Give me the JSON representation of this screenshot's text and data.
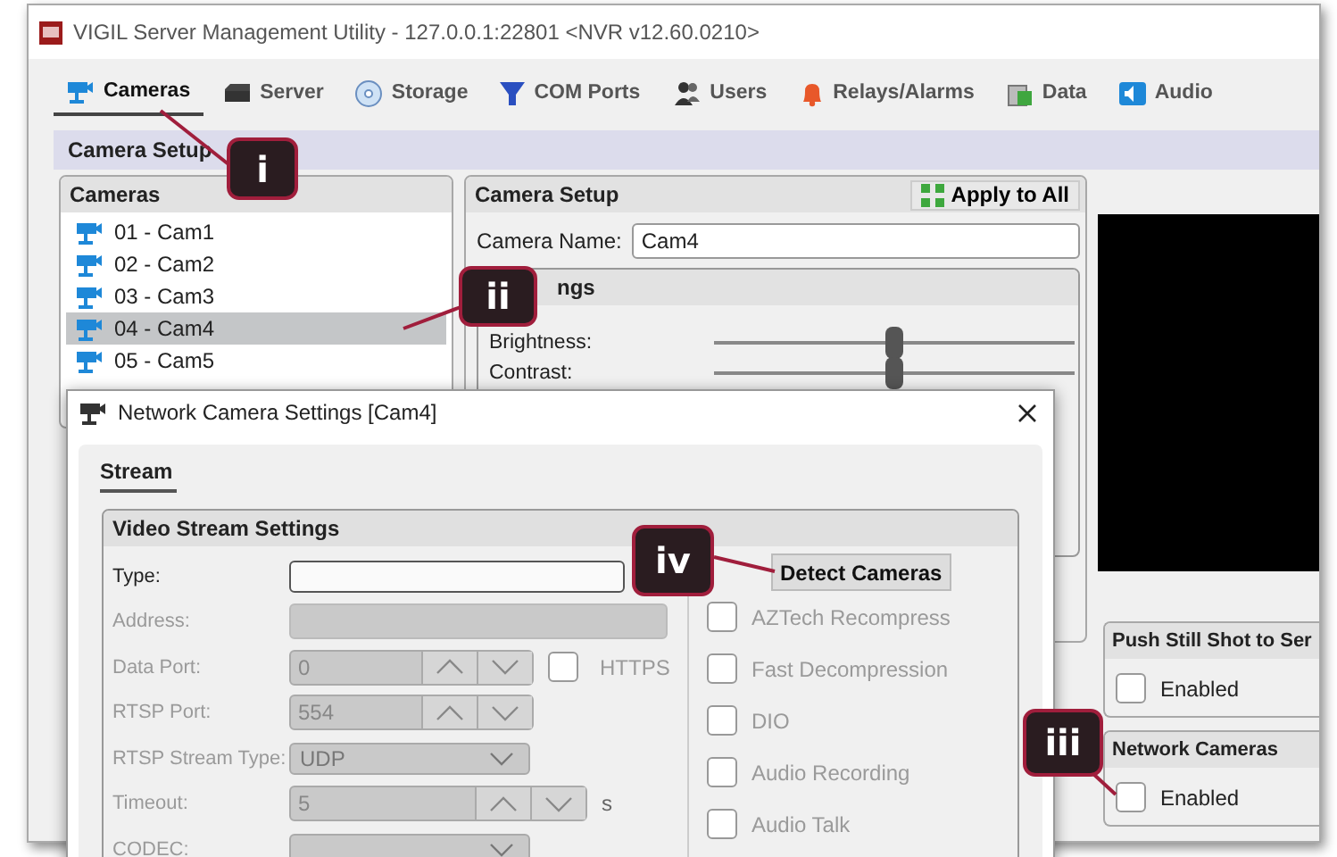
{
  "window": {
    "title": "VIGIL Server Management Utility - 127.0.0.1:22801 <NVR v12.60.0210>"
  },
  "tabs": [
    {
      "label": "Cameras",
      "selected": true
    },
    {
      "label": "Server",
      "selected": false
    },
    {
      "label": "Storage",
      "selected": false
    },
    {
      "label": "COM Ports",
      "selected": false
    },
    {
      "label": "Users",
      "selected": false
    },
    {
      "label": "Relays/Alarms",
      "selected": false
    },
    {
      "label": "Data",
      "selected": false
    },
    {
      "label": "Audio",
      "selected": false
    }
  ],
  "section_title": "Camera Setup",
  "cameras_panel": {
    "title": "Cameras",
    "items": [
      {
        "label": "01 - Cam1",
        "selected": false
      },
      {
        "label": "02 - Cam2",
        "selected": false
      },
      {
        "label": "03 - Cam3",
        "selected": false
      },
      {
        "label": "04 - Cam4",
        "selected": true
      },
      {
        "label": "05 - Cam5",
        "selected": false
      }
    ]
  },
  "camera_setup": {
    "title": "Camera Setup",
    "apply_button": "Apply to All",
    "name_label": "Camera Name:",
    "name_value": "Cam4",
    "settings": {
      "title": "ngs",
      "sliders": [
        {
          "label": "Brightness:",
          "level": 0.5
        },
        {
          "label": "Contrast:",
          "level": 0.5
        }
      ]
    }
  },
  "side_panels": [
    {
      "title": "Push Still Shot to Ser",
      "checkbox": {
        "label": "Enabled",
        "checked": false
      }
    },
    {
      "title": "Network Cameras",
      "checkbox": {
        "label": "Enabled",
        "checked": false
      }
    }
  ],
  "dialog": {
    "title": "Network Camera Settings [Cam4]",
    "tabs": [
      {
        "label": "Stream",
        "selected": true
      }
    ],
    "group_title": "Video Stream Settings",
    "detect_button": "Detect Cameras",
    "fields": [
      {
        "kind": "combo",
        "label": "Type:",
        "disabled": false
      },
      {
        "kind": "text",
        "label": "Address:",
        "disabled": true
      },
      {
        "kind": "spin",
        "label": "Data Port:",
        "value": "0",
        "disabled": true,
        "check": {
          "label": "HTTPS",
          "checked": false
        }
      },
      {
        "kind": "spin",
        "label": "RTSP Port:",
        "value": "554",
        "disabled": true
      },
      {
        "kind": "combo",
        "label": "RTSP Stream Type:",
        "value": "UDP",
        "disabled": true
      },
      {
        "kind": "spin",
        "label": "Timeout:",
        "value": "5",
        "unit": "s",
        "disabled": true
      },
      {
        "kind": "combo",
        "label": "CODEC:",
        "disabled": true
      }
    ],
    "options": [
      {
        "label": "AZTech Recompress",
        "checked": false,
        "disabled": true
      },
      {
        "label": "Fast Decompression",
        "checked": false,
        "disabled": true
      },
      {
        "label": "DIO",
        "checked": false,
        "disabled": true
      },
      {
        "label": "Audio Recording",
        "checked": false,
        "disabled": true
      },
      {
        "label": "Audio Talk",
        "checked": false,
        "disabled": true
      }
    ]
  },
  "callouts": [
    {
      "label": "i"
    },
    {
      "label": "ii"
    },
    {
      "label": "iii"
    },
    {
      "label": "iv"
    }
  ]
}
